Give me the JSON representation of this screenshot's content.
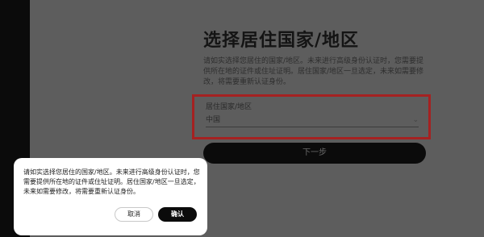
{
  "page": {
    "title": "选择居住国家/地区",
    "description": "请如实选择您居住的国家/地区。未来进行高级身份认证时，您需要提供所在地的证件或住址证明。居住国家/地区一旦选定，未来如需要修改，将需要重新认证身份。"
  },
  "region": {
    "label": "居住国家/地区",
    "selected": "中国"
  },
  "next_button": "下一步",
  "dialog": {
    "message": "请如实选择您居住的国家/地区。未来进行高级身份认证时，您需要提供所在地的证件或住址证明。居住国家/地区一旦选定，未来如需要修改，将需要重新认证身份。",
    "cancel": "取消",
    "confirm": "确认"
  }
}
